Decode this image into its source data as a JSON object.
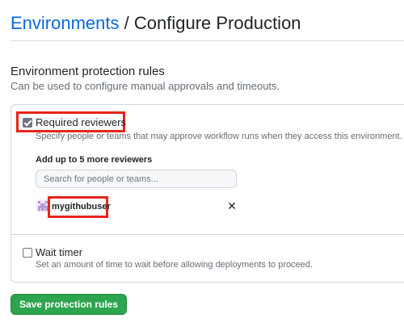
{
  "breadcrumb": {
    "parent": "Environments",
    "separator": " / ",
    "current": "Configure Production"
  },
  "protection": {
    "title": "Environment protection rules",
    "description": "Can be used to configure manual approvals and timeouts.",
    "required_reviewers": {
      "checked": true,
      "label": "Required reviewers",
      "description": "Specify people or teams that may approve workflow runs when they access this environment.",
      "add_label": "Add up to 5 more reviewers",
      "search_placeholder": "Search for people or teams...",
      "reviewers": [
        {
          "username": "mygithubuser",
          "avatar_icon": "identicon-avatar",
          "remove_icon": "close-icon"
        }
      ]
    },
    "wait_timer": {
      "checked": false,
      "label": "Wait timer",
      "description": "Set an amount of time to wait before allowing deployments to proceed."
    }
  },
  "save_button": {
    "label": "Save protection rules"
  },
  "colors": {
    "link": "#0969da",
    "primary_button": "#2da44e",
    "highlight": "#e8251a",
    "muted_text": "#656d76"
  }
}
